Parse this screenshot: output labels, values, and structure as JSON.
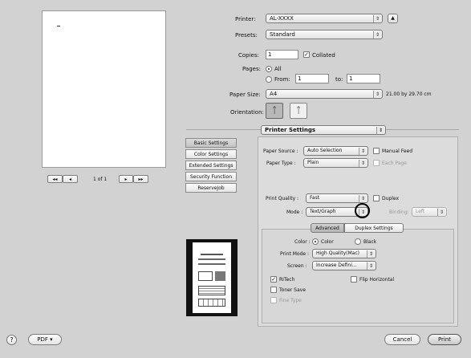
{
  "dialog": {
    "printer": {
      "label": "Printer:",
      "value": "AL-XXXX"
    },
    "presets": {
      "label": "Presets:",
      "value": "Standard"
    },
    "copies": {
      "label": "Copies:",
      "value": "1",
      "collated_label": "Collated",
      "collated": true
    },
    "pages": {
      "label": "Pages:",
      "all_label": "All",
      "from_label": "From:",
      "from_value": "1",
      "to_label": "to:",
      "to_value": "1"
    },
    "paper_size": {
      "label": "Paper Size:",
      "value": "A4",
      "dims": "21.00 by 29.70 cm"
    },
    "orientation": {
      "label": "Orientation:"
    },
    "pane_select": {
      "value": "Printer Settings"
    },
    "nav": {
      "first": "◂◂",
      "prev": "◂",
      "page_info": "1 of 1",
      "next": "▸",
      "last": "▸▸"
    },
    "side_buttons": [
      "Basic Settings",
      "Color Settings",
      "Extended Settings",
      "Security Function",
      "ReserveJob"
    ],
    "paper_source": {
      "label": "Paper Source :",
      "value": "Auto Selection",
      "manual_feed": "Manual Feed"
    },
    "paper_type": {
      "label": "Paper Type :",
      "value": "Plain",
      "each_page": "Each Page"
    },
    "print_quality": {
      "label": "Print Quality :",
      "value": "Fast",
      "duplex": "Duplex"
    },
    "mode": {
      "label": "Mode :",
      "value": "Text/Graph",
      "binding_label": "Binding:",
      "binding_value": "Left"
    },
    "tabs": {
      "advanced": "Advanced",
      "duplex_settings": "Duplex Settings"
    },
    "color": {
      "label": "Color :",
      "color_option": "Color",
      "black_option": "Black"
    },
    "print_mode": {
      "label": "Print Mode :",
      "value": "High Quality(Mac)"
    },
    "screen": {
      "label": "Screen :",
      "value": "Increase Defini..."
    },
    "options": {
      "ritech": "RITech",
      "flip_horizontal": "Flip Horizontal",
      "toner_save": "Toner Save",
      "fine_type": "Fine Type"
    },
    "footer": {
      "help": "?",
      "pdf": "PDF ▾",
      "cancel": "Cancel",
      "print": "Print"
    }
  }
}
